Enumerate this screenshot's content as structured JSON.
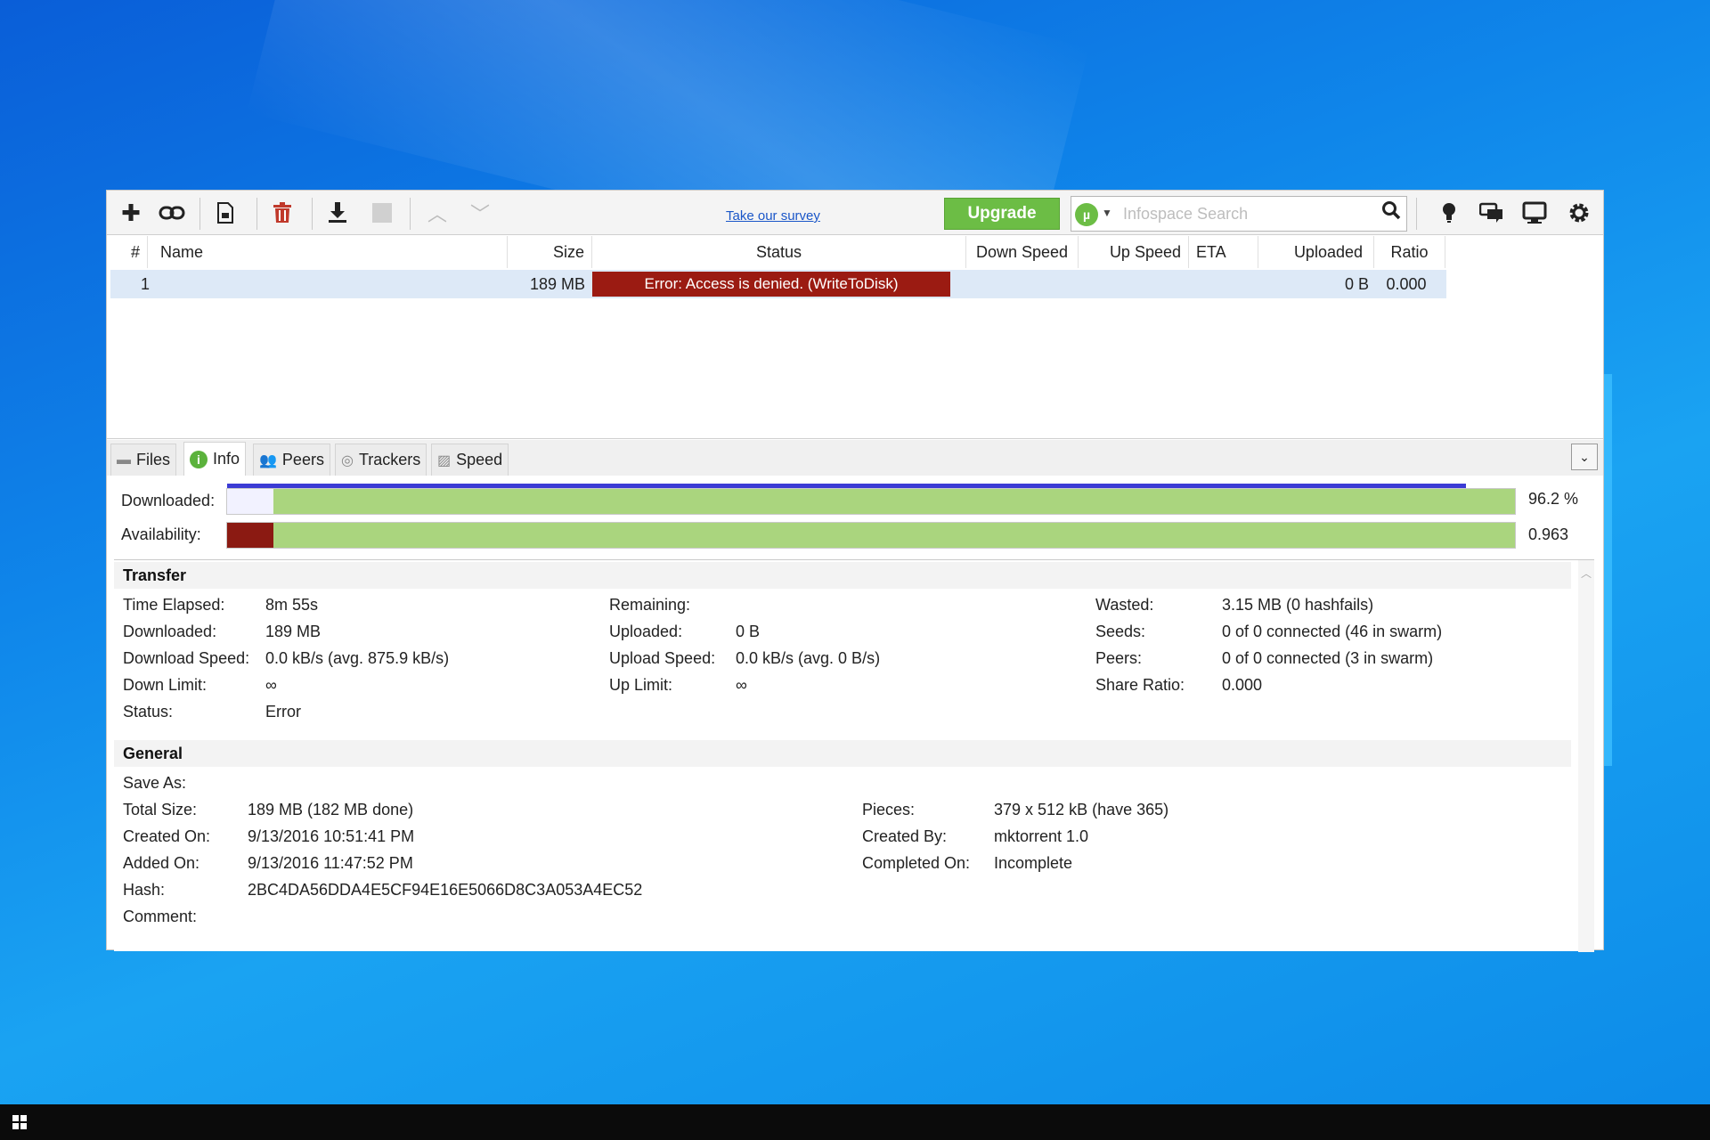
{
  "window": {
    "survey_link": "Take our survey",
    "upgrade_label": "Upgrade"
  },
  "search": {
    "placeholder": "Infospace Search",
    "logo_letter": "µ"
  },
  "toolbar_icons": [
    "add-icon",
    "link-icon",
    "file-icon",
    "trash-icon",
    "download-icon",
    "stop-icon",
    "up-arrow-icon",
    "down-arrow-icon",
    "bulb-icon",
    "chat-icon",
    "monitor-icon",
    "gear-icon"
  ],
  "columns": [
    "#",
    "Name",
    "Size",
    "Status",
    "Down Speed",
    "Up Speed",
    "ETA",
    "Uploaded",
    "Ratio"
  ],
  "torrents": [
    {
      "num": "1",
      "name": "",
      "size": "189 MB",
      "status": "Error: Access is denied.  (WriteToDisk)",
      "down_speed": "",
      "up_speed": "",
      "eta": "",
      "uploaded": "0 B",
      "ratio": "0.000"
    }
  ],
  "tabs": [
    "Files",
    "Info",
    "Peers",
    "Trackers",
    "Speed"
  ],
  "progress": {
    "downloaded_label": "Downloaded:",
    "downloaded_value": "96.2 %",
    "downloaded_fraction": 0.962,
    "availability_label": "Availability:",
    "availability_value": "0.963",
    "availability_fraction": 0.963
  },
  "transfer": {
    "title": "Transfer",
    "col1": [
      {
        "k": "Time Elapsed:",
        "v": "8m 55s"
      },
      {
        "k": "Downloaded:",
        "v": "189 MB"
      },
      {
        "k": "Download Speed:",
        "v": "0.0 kB/s (avg. 875.9 kB/s)"
      },
      {
        "k": "Down Limit:",
        "v": "∞"
      },
      {
        "k": "Status:",
        "v": "Error"
      }
    ],
    "col2": [
      {
        "k": "Remaining:",
        "v": ""
      },
      {
        "k": "Uploaded:",
        "v": "0 B"
      },
      {
        "k": "Upload Speed:",
        "v": "0.0 kB/s (avg. 0 B/s)"
      },
      {
        "k": "Up Limit:",
        "v": "∞"
      }
    ],
    "col3": [
      {
        "k": "Wasted:",
        "v": "3.15 MB (0 hashfails)"
      },
      {
        "k": "Seeds:",
        "v": "0 of 0 connected (46 in swarm)"
      },
      {
        "k": "Peers:",
        "v": "0 of 0 connected (3 in swarm)"
      },
      {
        "k": "Share Ratio:",
        "v": "0.000"
      }
    ]
  },
  "general": {
    "title": "General",
    "col1": [
      {
        "k": "Save As:",
        "v": ""
      },
      {
        "k": "Total Size:",
        "v": "189 MB (182 MB done)"
      },
      {
        "k": "Created On:",
        "v": "9/13/2016 10:51:41 PM"
      },
      {
        "k": "Added On:",
        "v": "9/13/2016 11:47:52 PM"
      },
      {
        "k": "Hash:",
        "v": "2BC4DA56DDA4E5CF94E16E5066D8C3A053A4EC52"
      },
      {
        "k": "Comment:",
        "v": ""
      }
    ],
    "col2": [
      {
        "k": "Pieces:",
        "v": "379 x 512 kB (have 365)"
      },
      {
        "k": "Created By:",
        "v": "mktorrent 1.0"
      },
      {
        "k": "Completed On:",
        "v": "Incomplete"
      }
    ]
  }
}
